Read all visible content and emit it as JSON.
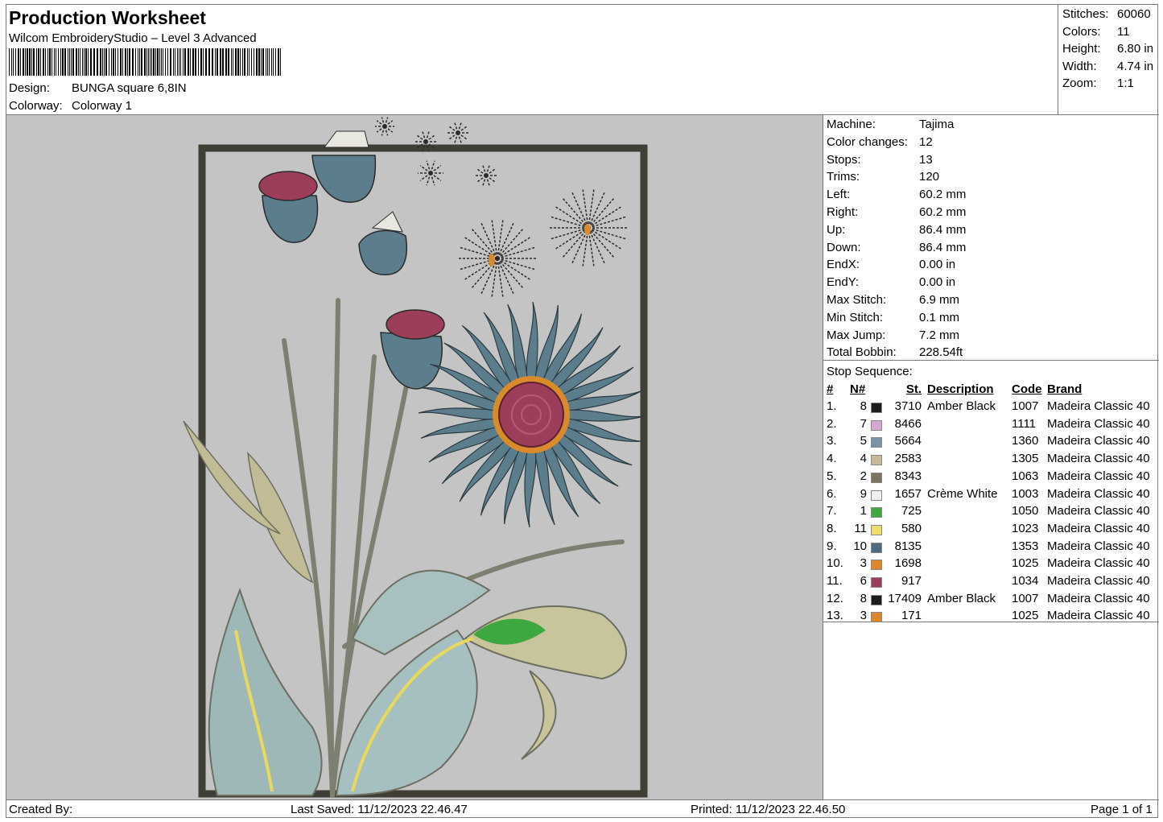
{
  "header": {
    "title": "Production Worksheet",
    "software": "Wilcom EmbroideryStudio – Level 3 Advanced",
    "design_label": "Design:",
    "design_value": "BUNGA square 6,8IN",
    "colorway_label": "Colorway:",
    "colorway_value": "Colorway 1"
  },
  "stats": [
    {
      "label": "Stitches:",
      "value": "60060"
    },
    {
      "label": "Colors:",
      "value": "11"
    },
    {
      "label": "Height:",
      "value": "6.80 in"
    },
    {
      "label": "Width:",
      "value": "4.74 in"
    },
    {
      "label": "Zoom:",
      "value": "1:1"
    }
  ],
  "machine": [
    {
      "label": "Machine:",
      "value": "Tajima"
    },
    {
      "label": "Color changes:",
      "value": "12"
    },
    {
      "label": "Stops:",
      "value": "13"
    },
    {
      "label": "Trims:",
      "value": "120"
    },
    {
      "label": "Left:",
      "value": "60.2 mm"
    },
    {
      "label": "Right:",
      "value": "60.2 mm"
    },
    {
      "label": "Up:",
      "value": "86.4 mm"
    },
    {
      "label": "Down:",
      "value": "86.4 mm"
    },
    {
      "label": "EndX:",
      "value": "0.00 in"
    },
    {
      "label": "EndY:",
      "value": "0.00 in"
    },
    {
      "label": "Max Stitch:",
      "value": "6.9 mm"
    },
    {
      "label": "Min Stitch:",
      "value": "0.1 mm"
    },
    {
      "label": "Max Jump:",
      "value": "7.2 mm"
    },
    {
      "label": "Total Bobbin:",
      "value": "228.54ft"
    }
  ],
  "stop_sequence": {
    "title": "Stop Sequence:",
    "headers": {
      "idx": "#",
      "n": "N#",
      "st": "St.",
      "desc": "Description",
      "code": "Code",
      "brand": "Brand"
    },
    "rows": [
      {
        "idx": "1.",
        "n": "8",
        "color": "#1c1c1c",
        "st": "3710",
        "desc": "Amber Black",
        "code": "1007",
        "brand": "Madeira Classic 40"
      },
      {
        "idx": "2.",
        "n": "7",
        "color": "#d4a8d0",
        "st": "8466",
        "desc": "",
        "code": "1111",
        "brand": "Madeira Classic 40"
      },
      {
        "idx": "3.",
        "n": "5",
        "color": "#7a93a6",
        "st": "5664",
        "desc": "",
        "code": "1360",
        "brand": "Madeira Classic 40"
      },
      {
        "idx": "4.",
        "n": "4",
        "color": "#c8b89a",
        "st": "2583",
        "desc": "",
        "code": "1305",
        "brand": "Madeira Classic 40"
      },
      {
        "idx": "5.",
        "n": "2",
        "color": "#7c745f",
        "st": "8343",
        "desc": "",
        "code": "1063",
        "brand": "Madeira Classic 40"
      },
      {
        "idx": "6.",
        "n": "9",
        "color": "#efefef",
        "st": "1657",
        "desc": "Crème White",
        "code": "1003",
        "brand": "Madeira Classic 40"
      },
      {
        "idx": "7.",
        "n": "1",
        "color": "#3da840",
        "st": "725",
        "desc": "",
        "code": "1050",
        "brand": "Madeira Classic 40"
      },
      {
        "idx": "8.",
        "n": "11",
        "color": "#f0de6a",
        "st": "580",
        "desc": "",
        "code": "1023",
        "brand": "Madeira Classic 40"
      },
      {
        "idx": "9.",
        "n": "10",
        "color": "#4e6a80",
        "st": "8135",
        "desc": "",
        "code": "1353",
        "brand": "Madeira Classic 40"
      },
      {
        "idx": "10.",
        "n": "3",
        "color": "#e08628",
        "st": "1698",
        "desc": "",
        "code": "1025",
        "brand": "Madeira Classic 40"
      },
      {
        "idx": "11.",
        "n": "6",
        "color": "#9c3e5a",
        "st": "917",
        "desc": "",
        "code": "1034",
        "brand": "Madeira Classic 40"
      },
      {
        "idx": "12.",
        "n": "8",
        "color": "#1c1c1c",
        "st": "17409",
        "desc": "Amber Black",
        "code": "1007",
        "brand": "Madeira Classic 40"
      },
      {
        "idx": "13.",
        "n": "3",
        "color": "#e08628",
        "st": "171",
        "desc": "",
        "code": "1025",
        "brand": "Madeira Classic 40"
      }
    ]
  },
  "footer": {
    "created_by": "Created By:",
    "last_saved": "Last Saved: 11/12/2023 22.46.47",
    "printed": "Printed: 11/12/2023 22.46.50",
    "page": "Page 1 of 1"
  }
}
